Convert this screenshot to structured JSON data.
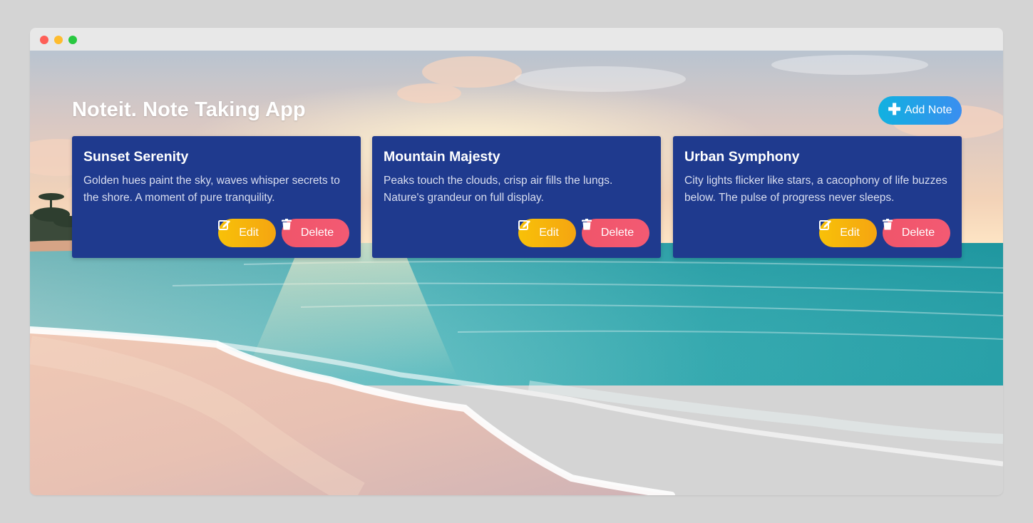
{
  "app": {
    "title": "Noteit. Note Taking App",
    "add_note_label": "Add Note",
    "edit_label": "Edit",
    "delete_label": "Delete"
  },
  "notes": [
    {
      "title": "Sunset Serenity",
      "body": "Golden hues paint the sky, waves whisper secrets to the shore. A moment of pure tranquility."
    },
    {
      "title": "Mountain Majesty",
      "body": "Peaks touch the clouds, crisp air fills the lungs. Nature's grandeur on full display."
    },
    {
      "title": "Urban Symphony",
      "body": "City lights flicker like stars, a cacophony of life buzzes below. The pulse of progress never sleeps."
    }
  ],
  "icons": {
    "add": "plus-icon",
    "edit": "edit-icon",
    "delete": "trash-icon"
  },
  "colors": {
    "card_background": "#1f3a8e",
    "add_button": "#1ea8e6",
    "edit_button": "#f7b80c",
    "delete_button": "#f2566e"
  }
}
